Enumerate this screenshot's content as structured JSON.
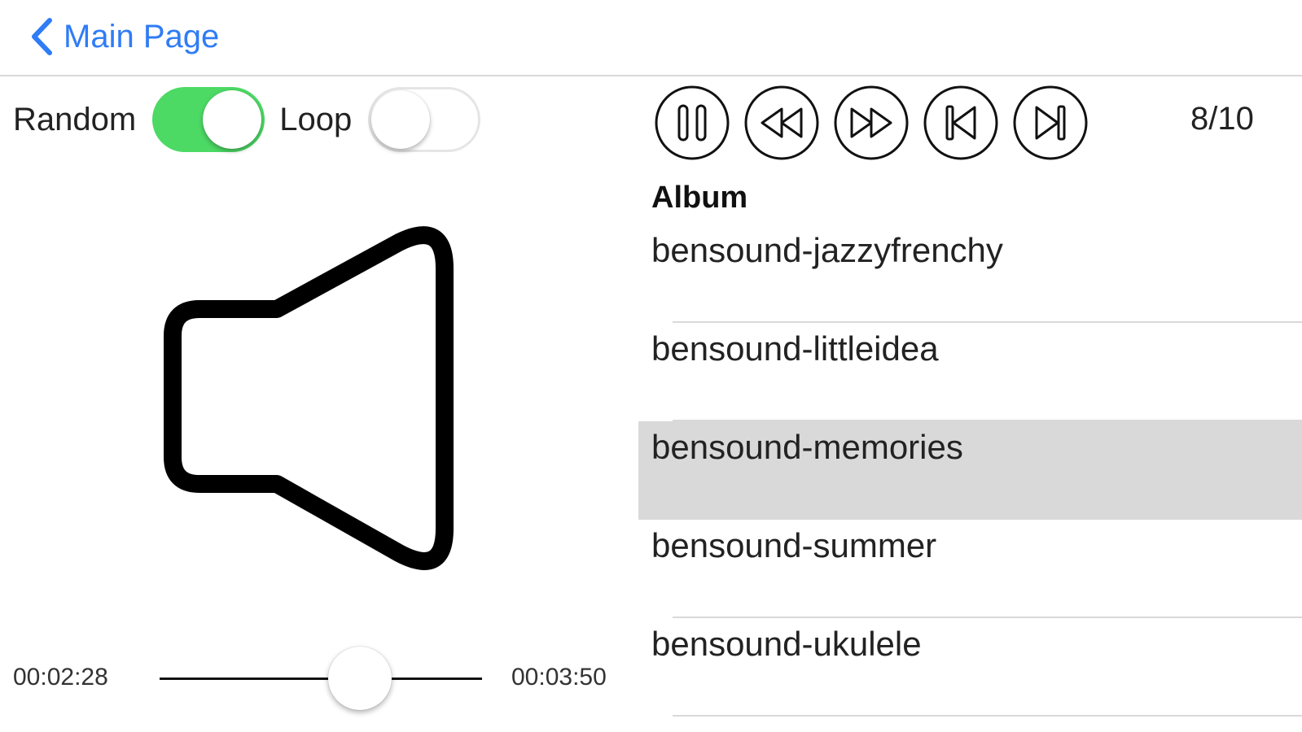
{
  "nav": {
    "back_label": "Main Page"
  },
  "options": {
    "random_label": "Random",
    "random_on": true,
    "loop_label": "Loop",
    "loop_on": false
  },
  "player": {
    "current_time": "00:02:28",
    "total_time": "00:03:50",
    "progress": 0.62,
    "track_position": "8/10",
    "buttons": [
      "pause-icon",
      "rewind-icon",
      "fast-forward-icon",
      "skip-back-icon",
      "skip-forward-icon"
    ]
  },
  "playlist": {
    "header": "Album",
    "songs": [
      {
        "name": "bensound-jazzyfrenchy",
        "selected": false
      },
      {
        "name": "bensound-littleidea",
        "selected": false
      },
      {
        "name": "bensound-memories",
        "selected": true
      },
      {
        "name": "bensound-summer",
        "selected": false
      },
      {
        "name": "bensound-ukulele",
        "selected": false
      }
    ]
  },
  "colors": {
    "accent": "#2f7cf6",
    "toggle_on": "#4cd964",
    "selected_row": "#d9d9d9"
  }
}
